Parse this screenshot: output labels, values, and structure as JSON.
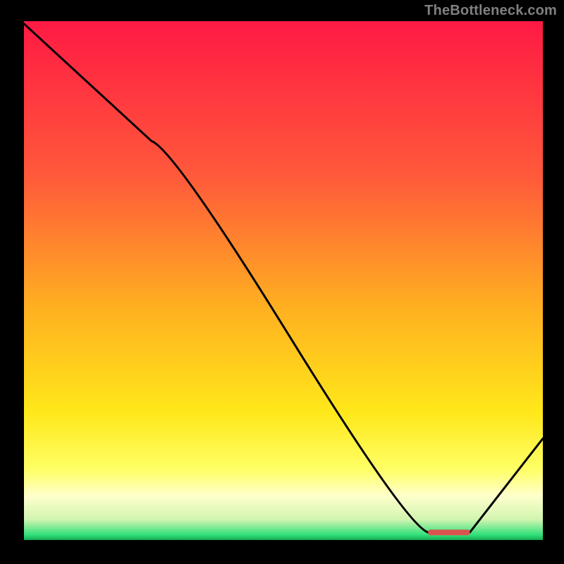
{
  "watermark": "TheBottleneck.com",
  "chart_data": {
    "type": "line",
    "title": "",
    "xlabel": "",
    "ylabel": "",
    "xlim": [
      0,
      100
    ],
    "ylim": [
      0,
      100
    ],
    "grid": false,
    "legend": null,
    "series": [
      {
        "name": "curve",
        "x": [
          0,
          25,
          78,
          86,
          100
        ],
        "y": [
          100,
          77,
          2,
          2,
          20
        ]
      }
    ],
    "marker": {
      "name": "highlight-segment",
      "x_start": 78,
      "x_end": 86,
      "y": 2,
      "color": "#d9534f"
    },
    "background_gradient": {
      "stops": [
        {
          "pos": 0.0,
          "color": "#ff1a44"
        },
        {
          "pos": 0.3,
          "color": "#ff5a3a"
        },
        {
          "pos": 0.55,
          "color": "#ffb020"
        },
        {
          "pos": 0.75,
          "color": "#ffe81a"
        },
        {
          "pos": 0.86,
          "color": "#ffff66"
        },
        {
          "pos": 0.91,
          "color": "#ffffcc"
        },
        {
          "pos": 0.955,
          "color": "#d2f5b0"
        },
        {
          "pos": 0.985,
          "color": "#2fe07a"
        },
        {
          "pos": 1.0,
          "color": "#0a8a3c"
        }
      ]
    }
  }
}
